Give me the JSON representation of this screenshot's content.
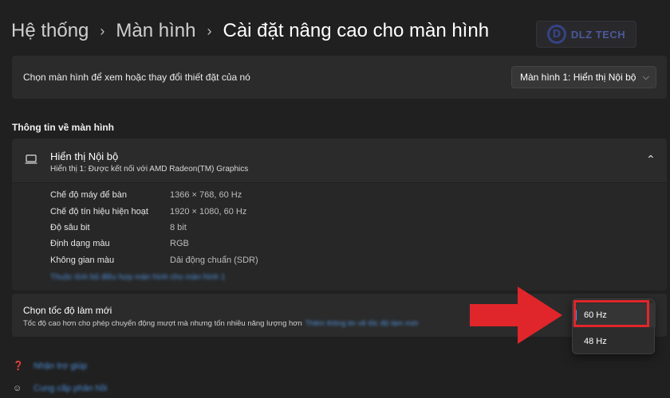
{
  "breadcrumb": {
    "items": [
      "Hệ thống",
      "Màn hình"
    ],
    "current": "Cài đặt nâng cao cho màn hình",
    "separator": "›"
  },
  "logo": {
    "mark": "D",
    "text": "DLZ TECH"
  },
  "display_select": {
    "label": "Chọn màn hình để xem hoặc thay đổi thiết đặt của nó",
    "value": "Màn hình 1: Hiển thị Nội bộ"
  },
  "section_title": "Thông tin về màn hình",
  "display_info": {
    "title": "Hiển thị Nội bộ",
    "subtitle": "Hiển thị 1: Được kết nối với AMD Radeon(TM) Graphics",
    "rows": [
      {
        "key": "Chế độ máy để bàn",
        "value": "1366 × 768, 60 Hz"
      },
      {
        "key": "Chế độ tín hiệu hiện hoạt",
        "value": "1920 × 1080, 60 Hz"
      },
      {
        "key": "Độ sâu bit",
        "value": "8 bit"
      },
      {
        "key": "Định dạng màu",
        "value": "RGB"
      },
      {
        "key": "Không gian màu",
        "value": "Dải động chuẩn (SDR)"
      }
    ],
    "adapter_link": "Thuộc tính bộ điều hợp màn hình cho màn hình 1"
  },
  "refresh_rate": {
    "title": "Chọn tốc độ làm mới",
    "description": "Tốc độ cao hơn cho phép chuyển động mượt mà nhưng tốn nhiều năng lượng hơn",
    "link": "Thêm thông tin về tốc độ làm mới",
    "options": [
      "60 Hz",
      "48 Hz"
    ],
    "selected": "60 Hz"
  },
  "help_links": [
    {
      "icon": "help-icon",
      "label": "Nhận trợ giúp"
    },
    {
      "icon": "feedback-icon",
      "label": "Cung cấp phản hồi"
    }
  ],
  "colors": {
    "background": "#202020",
    "card": "#2b2b2b",
    "accent": "#4c8ee6",
    "annotation_red": "#e0262b"
  }
}
